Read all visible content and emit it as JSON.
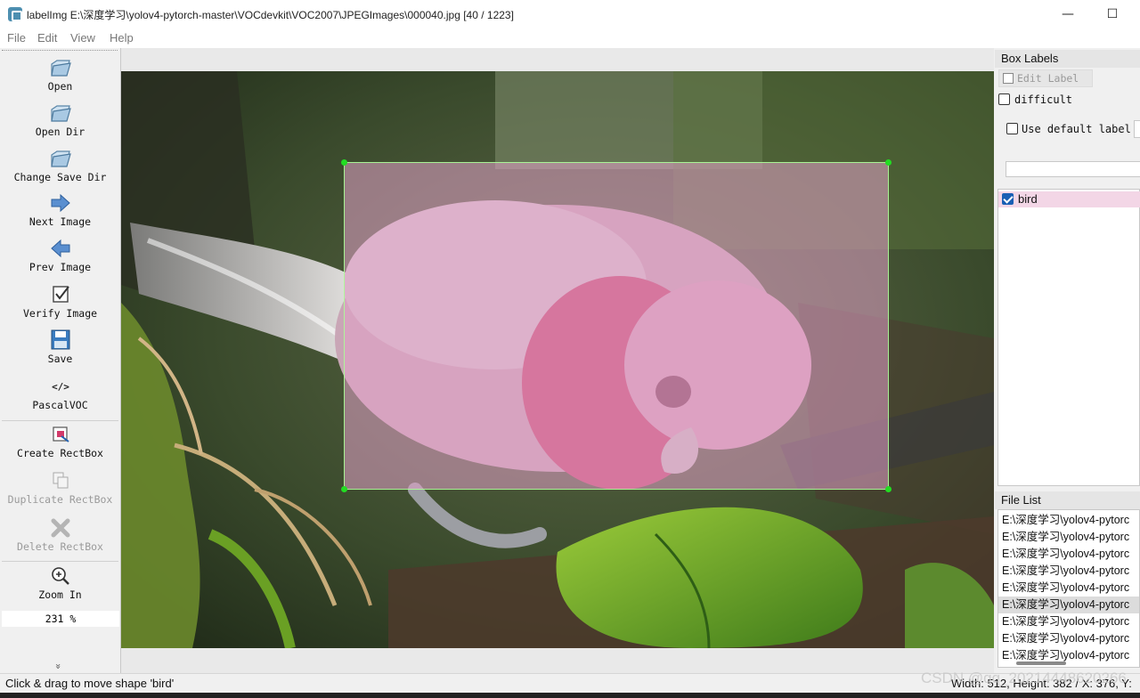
{
  "window": {
    "title": "labelImg E:\\深度学习\\yolov4-pytorch-master\\VOCdevkit\\VOC2007\\JPEGImages\\000040.jpg [40 / 1223]",
    "minimize_glyph": "—",
    "maximize_glyph": "☐"
  },
  "menu": [
    "File",
    "Edit",
    "View",
    "Help"
  ],
  "toolbar": {
    "items": [
      {
        "label": "Open",
        "icon": "folder-icon"
      },
      {
        "label": "Open Dir",
        "icon": "folder-icon"
      },
      {
        "label": "Change Save Dir",
        "icon": "folder-icon"
      },
      {
        "label": "Next Image",
        "icon": "arrow-right-icon"
      },
      {
        "label": "Prev Image",
        "icon": "arrow-left-icon"
      },
      {
        "label": "Verify Image",
        "icon": "checkbox-icon"
      },
      {
        "label": "Save",
        "icon": "floppy-disk-icon"
      },
      {
        "label": "PascalVOC",
        "icon": "code-icon"
      },
      {
        "label": "Create RectBox",
        "icon": "create-rect-icon"
      },
      {
        "label": "Duplicate RectBox",
        "icon": "duplicate-icon"
      },
      {
        "label": "Delete RectBox",
        "icon": "delete-x-icon"
      },
      {
        "label": "Zoom In",
        "icon": "zoom-in-icon"
      }
    ],
    "zoom_value": "231 %",
    "more_glyph": "»"
  },
  "right_panel": {
    "box_labels_title": "Box Labels",
    "edit_label": "Edit Label",
    "difficult_label": "difficult",
    "difficult_checked": false,
    "use_default_label": "Use default label",
    "use_default_checked": false,
    "default_label_value": "",
    "labels": [
      {
        "text": "bird",
        "checked": true
      }
    ],
    "file_list_title": "File List",
    "files": [
      "E:\\深度学习\\yolov4-pytorc",
      "E:\\深度学习\\yolov4-pytorc",
      "E:\\深度学习\\yolov4-pytorc",
      "E:\\深度学习\\yolov4-pytorc",
      "E:\\深度学习\\yolov4-pytorc",
      "E:\\深度学习\\yolov4-pytorc",
      "E:\\深度学习\\yolov4-pytorc",
      "E:\\深度学习\\yolov4-pytorc",
      "E:\\深度学习\\yolov4-pytorc"
    ],
    "selected_file_index": 5
  },
  "status": {
    "message": "Click & drag to move shape 'bird'",
    "dims": "Width: 512, Height: 382 / X: 376, Y:"
  },
  "watermark": "CSDN @qq_20214448620266",
  "colors": {
    "box_fill": "#e1a0c8",
    "box_border": "#aaff96",
    "handle": "#22dd22",
    "selected_label_row": "#f3d6e6"
  }
}
